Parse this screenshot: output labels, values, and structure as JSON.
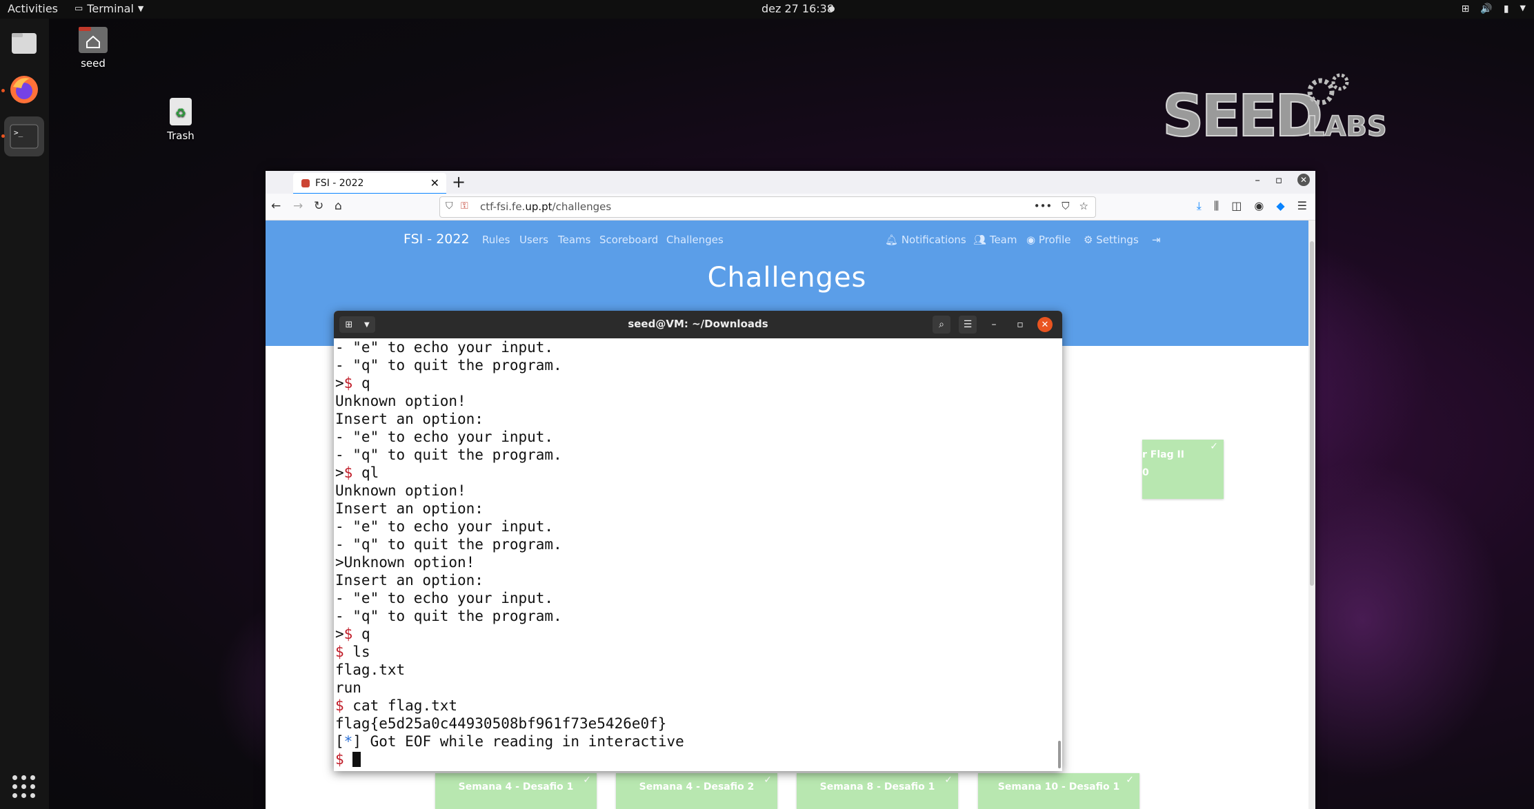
{
  "topbar": {
    "activities": "Activities",
    "app_name": "Terminal",
    "clock": "dez 27  16:38"
  },
  "desktop": {
    "home_label": "seed",
    "trash_label": "Trash"
  },
  "browser": {
    "tab_title": "FSI - 2022",
    "url_prefix": "ctf-fsi.fe.",
    "url_domain": "up.pt",
    "url_path": "/challenges"
  },
  "site": {
    "brand": "FSI - 2022",
    "nav": [
      "Rules",
      "Users",
      "Teams",
      "Scoreboard",
      "Challenges"
    ],
    "user_nav": [
      "Notifications",
      "Team",
      "Profile",
      "Settings"
    ],
    "title": "Challenges",
    "cards": [
      {
        "title": "Semana 4 - Desafio 1"
      },
      {
        "title": "Semana 4 - Desafio 2"
      },
      {
        "title": "Semana 8 - Desafio 1"
      },
      {
        "title": "Semana 10 - Desafio 1"
      }
    ],
    "partial_card": {
      "title": "r Flag II",
      "sub": "0"
    }
  },
  "terminal": {
    "title": "seed@VM: ~/Downloads",
    "lines": [
      "- \"e\" to echo your input.",
      "- \"q\" to quit the program.",
      ">$ q",
      "Unknown option!",
      "Insert an option:",
      "- \"e\" to echo your input.",
      "- \"q\" to quit the program.",
      ">$ ql",
      "Unknown option!",
      "Insert an option:",
      "- \"e\" to echo your input.",
      "- \"q\" to quit the program.",
      ">Unknown option!",
      "Insert an option:",
      "- \"e\" to echo your input.",
      "- \"q\" to quit the program.",
      ">$ q",
      "$ ls",
      "flag.txt",
      "run",
      "$ cat flag.txt",
      "flag{e5d25a0c44930508bf961f73e5426e0f}",
      "[*] Got EOF while reading in interactive",
      "$ "
    ]
  }
}
